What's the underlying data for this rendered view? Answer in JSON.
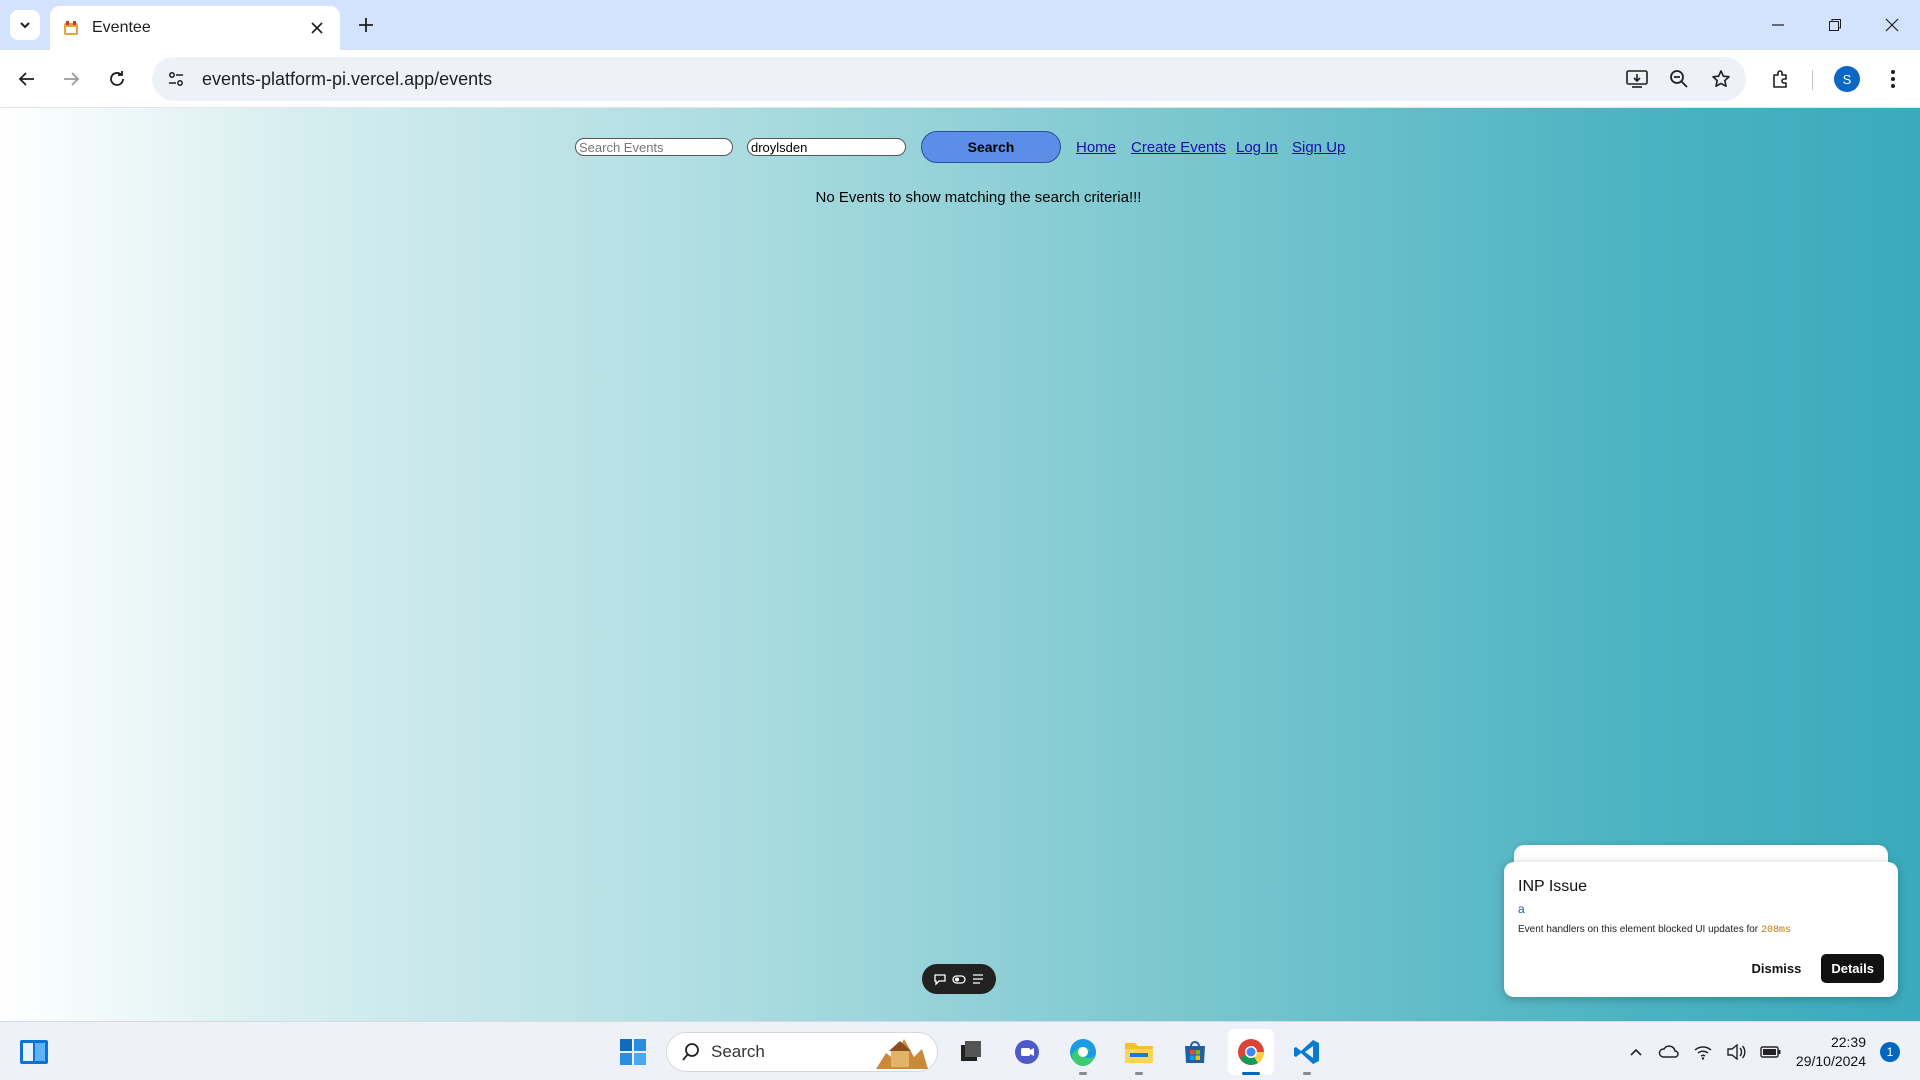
{
  "browser": {
    "tab_title": "Eventee",
    "url": "events-platform-pi.vercel.app/events",
    "profile_initial": "S",
    "icons": [
      "tab-search-icon",
      "favicon",
      "close-icon",
      "plus-icon",
      "minimize-icon",
      "restore-icon",
      "close-window-icon",
      "back-icon",
      "forward-icon",
      "reload-icon",
      "site-info-icon",
      "install-app-icon",
      "zoom-icon",
      "star-icon",
      "extensions-icon",
      "menu-icon"
    ]
  },
  "page": {
    "search_placeholder": "Search Events",
    "location_value": "droylsden",
    "search_button": "Search",
    "nav": [
      "Home",
      "Create Events",
      "Log In",
      "Sign Up"
    ],
    "empty_message": "No Events to show matching the search criteria!!!"
  },
  "inp_panel": {
    "title": "INP Issue",
    "element": "a",
    "description": "Event handlers on this element blocked UI updates for",
    "duration": "208ms",
    "dismiss": "Dismiss",
    "details": "Details"
  },
  "taskbar": {
    "search_label": "Search",
    "time": "22:39",
    "date": "29/10/2024",
    "notifications": "1",
    "apps": [
      "start-icon",
      "search-icon",
      "task-view-icon",
      "teams-icon",
      "edge-icon",
      "file-explorer-icon",
      "store-icon",
      "chrome-icon",
      "vscode-icon"
    ]
  },
  "colors": {
    "tabstrip": "#d3e3fd",
    "search_button": "#5b8ee6",
    "link": "#1a0dab",
    "gradient_end": "#3aaabc",
    "accent": "#0067c0"
  }
}
